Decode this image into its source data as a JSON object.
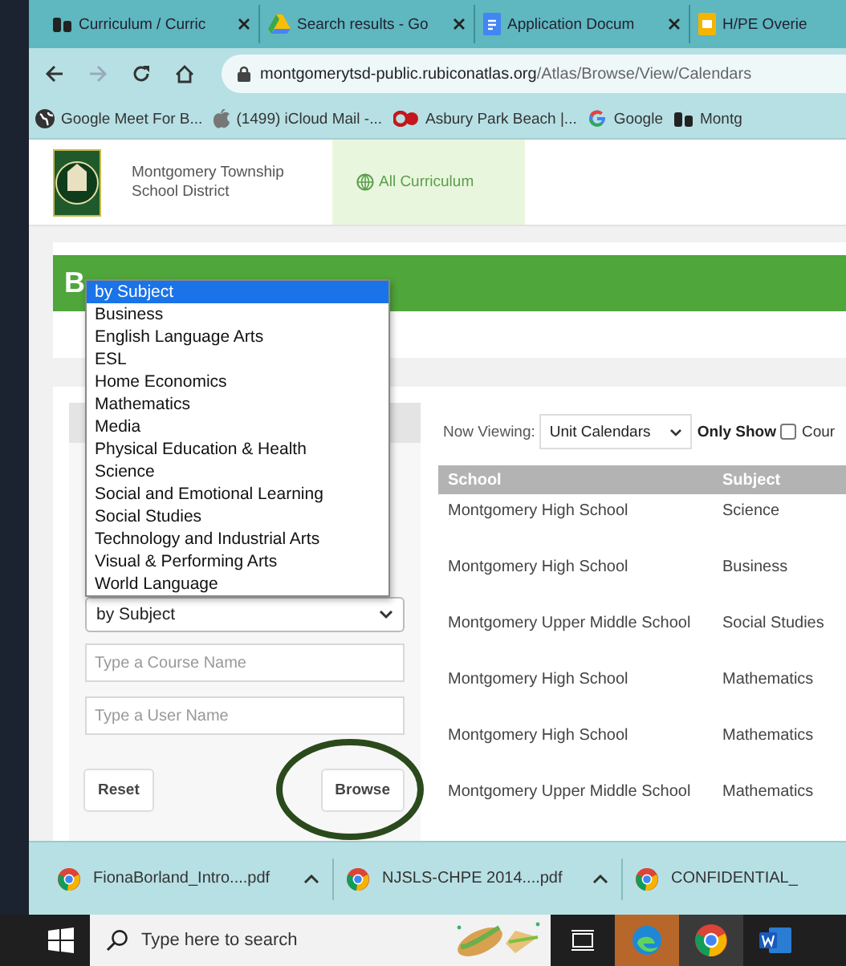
{
  "browser": {
    "tabs": [
      {
        "kind": "blackboard",
        "label": "Curriculum / Curric",
        "closable": true
      },
      {
        "kind": "drive",
        "label": "Search results - Go",
        "closable": true
      },
      {
        "kind": "docs",
        "label": "Application Docum",
        "closable": true
      },
      {
        "kind": "slides",
        "label": "H/PE Overie"
      }
    ],
    "address_bar": {
      "host": "montgomerytsd-public.rubiconatlas.org",
      "path": "/Atlas/Browse/View/Calendars"
    },
    "bookmarks": [
      {
        "kind": "globe",
        "label": "Google Meet For B..."
      },
      {
        "kind": "apple",
        "label": "(1499) iCloud Mail -..."
      },
      {
        "kind": "cp",
        "label": "Asbury Park Beach |..."
      },
      {
        "kind": "google",
        "label": "Google"
      },
      {
        "kind": "blackboard",
        "label": "Montg"
      }
    ]
  },
  "page": {
    "header": {
      "district_name": "Montgomery Township School District",
      "nav_link": "All Curriculum"
    },
    "banner": {
      "title": "B"
    },
    "filters": {
      "subject_dropdown": {
        "options": [
          {
            "label": "by Subject",
            "selected": true
          },
          {
            "label": "Business",
            "selected": false
          },
          {
            "label": "English Language Arts",
            "selected": false
          },
          {
            "label": "ESL",
            "selected": false
          },
          {
            "label": "Home Economics",
            "selected": false
          },
          {
            "label": "Mathematics",
            "selected": false
          },
          {
            "label": "Media",
            "selected": false
          },
          {
            "label": "Physical Education & Health",
            "selected": false
          },
          {
            "label": "Science",
            "selected": false
          },
          {
            "label": "Social and Emotional Learning",
            "selected": false
          },
          {
            "label": "Social Studies",
            "selected": false
          },
          {
            "label": "Technology and Industrial Arts",
            "selected": false
          },
          {
            "label": "Visual & Performing Arts",
            "selected": false
          },
          {
            "label": "World Language",
            "selected": false
          }
        ]
      },
      "subject_select": {
        "value": "by Subject"
      },
      "course_field": {
        "placeholder": "Type a Course Name"
      },
      "user_field": {
        "placeholder": "Type a User Name"
      },
      "buttons": [
        "Reset",
        "Browse"
      ]
    },
    "results": {
      "viewing_label": "Now Viewing:",
      "view_select": {
        "value": "Unit Calendars"
      },
      "only_show": {
        "label": "Only Show",
        "option": "Cour",
        "checked": false
      },
      "table": {
        "columns": [
          "School",
          "Subject"
        ],
        "rows": [
          [
            "Montgomery High School",
            "Science"
          ],
          [
            "Montgomery High School",
            "Business"
          ],
          [
            "Montgomery Upper Middle School",
            "Social Studies"
          ],
          [
            "Montgomery High School",
            "Mathematics"
          ],
          [
            "Montgomery High School",
            "Mathematics"
          ],
          [
            "Montgomery Upper Middle School",
            "Mathematics"
          ]
        ]
      }
    }
  },
  "downloads": [
    {
      "name": "FionaBorland_Intro....pdf",
      "menu": true
    },
    {
      "name": "NJSLS-CHPE 2014....pdf",
      "menu": true
    },
    {
      "name": "CONFIDENTIAL_"
    }
  ],
  "taskbar": {
    "search": {
      "placeholder": "Type here to search"
    }
  }
}
